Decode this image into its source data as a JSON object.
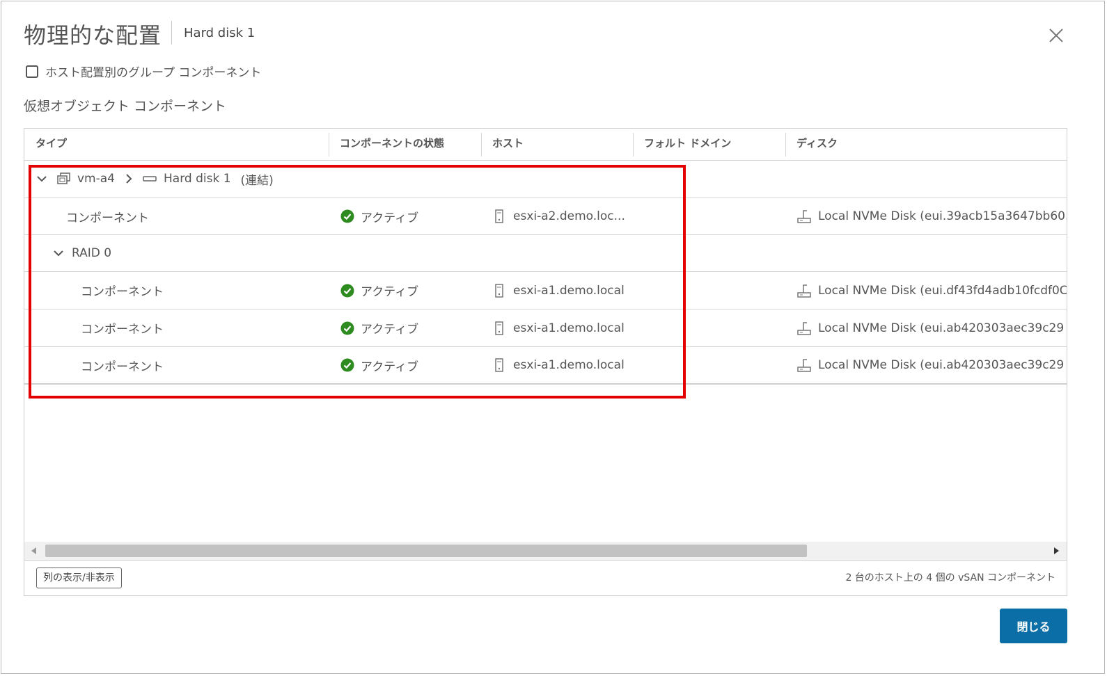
{
  "dialog": {
    "title": "物理的な配置",
    "subtitle": "Hard disk 1",
    "group_checkbox_label": "ホスト配置別のグループ コンポーネント",
    "group_checkbox_checked": false,
    "section_label": "仮想オブジェクト コンポーネント",
    "close_button_label": "閉じる",
    "close_icon": "close-icon"
  },
  "grid": {
    "columns": [
      "タイプ",
      "コンポーネントの状態",
      "ホスト",
      "フォルト ドメイン",
      "ディスク"
    ],
    "path": {
      "vm": "vm-a4",
      "disk": "Hard disk 1",
      "disk_suffix": "(連結)"
    },
    "raid_label": "RAID 0",
    "rows": [
      {
        "type": "コンポーネント",
        "state": "アクティブ",
        "host": "esxi-a2.demo.loc...",
        "fault_domain": "",
        "disk": "Local NVMe Disk (eui.39acb15a3647bb60."
      },
      {
        "type": "コンポーネント",
        "state": "アクティブ",
        "host": "esxi-a1.demo.local",
        "fault_domain": "",
        "disk": "Local NVMe Disk (eui.df43fd4adb10fcdf0C"
      },
      {
        "type": "コンポーネント",
        "state": "アクティブ",
        "host": "esxi-a1.demo.local",
        "fault_domain": "",
        "disk": "Local NVMe Disk (eui.ab420303aec39c29"
      },
      {
        "type": "コンポーネント",
        "state": "アクティブ",
        "host": "esxi-a1.demo.local",
        "fault_domain": "",
        "disk": "Local NVMe Disk (eui.ab420303aec39c29"
      }
    ],
    "column_toggle_label": "列の表示/非表示",
    "footer_info": "2 台のホスト上の 4 個の vSAN コンポーネント"
  },
  "colors": {
    "accent": "#0c6ea6",
    "status_active": "#2e8b1f",
    "highlight": "#e50000"
  },
  "icons": {
    "expand": "chevron-down-icon",
    "breadcrumb_sep": "chevron-right-icon",
    "vm": "vm-icon",
    "disk": "hard-disk-icon",
    "status": "check-circle-icon",
    "host": "host-icon",
    "storage": "storage-disk-icon"
  }
}
